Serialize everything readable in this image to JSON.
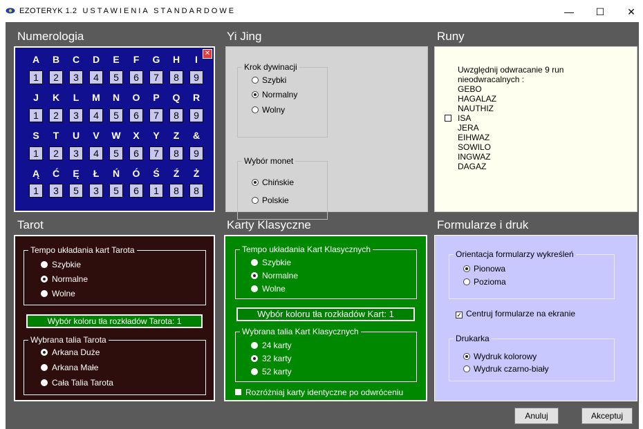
{
  "window": {
    "title": "EZOTERYK 1.2",
    "subtitle": "USTAWIENIA STANDARDOWE",
    "minimize": "—",
    "maximize": "☐",
    "close": "✕"
  },
  "numerologia": {
    "title": "Numerologia",
    "close_glyph": "✕",
    "rows": [
      {
        "letters": [
          "A",
          "B",
          "C",
          "D",
          "E",
          "F",
          "G",
          "H",
          "I"
        ],
        "numbers": [
          "1",
          "2",
          "3",
          "4",
          "5",
          "6",
          "7",
          "8",
          "9"
        ]
      },
      {
        "letters": [
          "J",
          "K",
          "L",
          "M",
          "N",
          "O",
          "P",
          "Q",
          "R"
        ],
        "numbers": [
          "1",
          "2",
          "3",
          "4",
          "5",
          "6",
          "7",
          "8",
          "9"
        ]
      },
      {
        "letters": [
          "S",
          "T",
          "U",
          "V",
          "W",
          "X",
          "Y",
          "Z",
          "&"
        ],
        "numbers": [
          "1",
          "2",
          "3",
          "4",
          "5",
          "6",
          "7",
          "8",
          "9"
        ]
      },
      {
        "letters": [
          "Ą",
          "Ć",
          "Ę",
          "Ł",
          "Ń",
          "Ó",
          "Ś",
          "Ź",
          "Ż"
        ],
        "numbers": [
          "1",
          "3",
          "5",
          "3",
          "5",
          "6",
          "1",
          "8",
          "8"
        ]
      }
    ]
  },
  "yijing": {
    "title": "Yi Jing",
    "krok_title": "Krok dywinacji",
    "krok_options": [
      "Szybki",
      "Normalny",
      "Wolny"
    ],
    "krok_selected": "Normalny",
    "monety_title": "Wybór monet",
    "monety_options": [
      "Chińskie",
      "Polskie"
    ],
    "monety_selected": "Chińskie"
  },
  "runy": {
    "title": "Runy",
    "line1": "Uwzględnij odwracanie 9 run",
    "line2": "nieodwracalnych :",
    "runes": [
      "GEBO",
      "HAGALAZ",
      "NAUTHIZ",
      "ISA",
      "JERA",
      "EIHWAZ",
      "SOWILO",
      "INGWAZ",
      "DAGAZ"
    ],
    "checked": false
  },
  "tarot": {
    "title": "Tarot",
    "tempo_title": "Tempo układania kart Tarota",
    "tempo_options": [
      "Szybkie",
      "Normalne",
      "Wolne"
    ],
    "tempo_selected": "Normalne",
    "color_button": "Wybór koloru tła rozkładów Tarota: 1",
    "talia_title": "Wybrana talia Tarota",
    "talia_options": [
      "Arkana Duże",
      "Arkana Małe",
      "Cała Talia Tarota"
    ],
    "talia_selected": "Arkana Duże"
  },
  "karty": {
    "title": "Karty Klasyczne",
    "tempo_title": "Tempo układania Kart Klasycznych",
    "tempo_options": [
      "Szybkie",
      "Normalne",
      "Wolne"
    ],
    "tempo_selected": "Normalne",
    "color_button": "Wybór koloru tła rozkładów Kart: 1",
    "talia_title": "Wybrana talia Kart Klasycznych",
    "talia_options": [
      "24 karty",
      "32 karty",
      "52 karty"
    ],
    "talia_selected": "32 karty",
    "distinguish_label": "Rozróżniaj karty identyczne po odwróceniu",
    "distinguish_checked": false
  },
  "formularze": {
    "title": "Formularze i druk",
    "orient_title": "Orientacja formularzy wykreśleń",
    "orient_options": [
      "Pionowa",
      "Pozioma"
    ],
    "orient_selected": "Pionowa",
    "center_label": "Centruj formularze na ekranie",
    "center_checked": true,
    "printer_title": "Drukarka",
    "printer_options": [
      "Wydruk kolorowy",
      "Wydruk czarno-biały"
    ],
    "printer_selected": "Wydruk kolorowy"
  },
  "buttons": {
    "cancel": "Anuluj",
    "accept": "Akceptuj"
  }
}
